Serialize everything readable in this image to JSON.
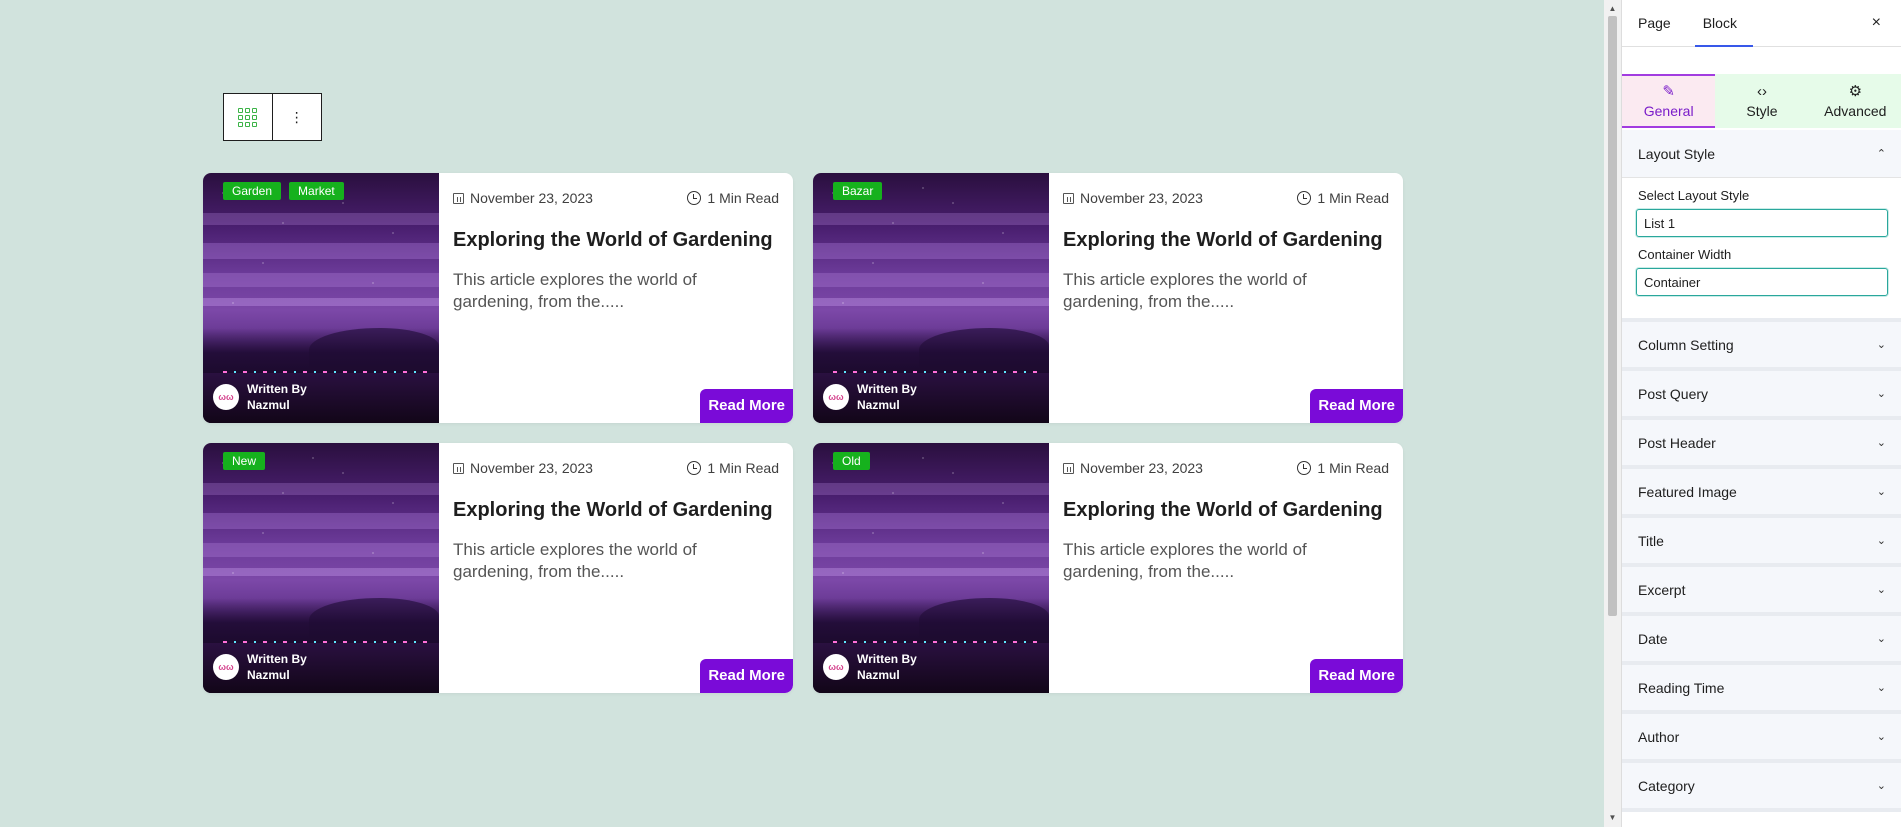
{
  "toolbar": {
    "layout_icon": "grid-layout-icon",
    "more_icon": "more-vertical-icon",
    "more_glyph": "⋮"
  },
  "posts": [
    {
      "tags": [
        "Garden",
        "Market"
      ],
      "date": "November 23, 2023",
      "read_time": "1 Min Read",
      "title": "Exploring the World of Gardening",
      "excerpt": "This article explores the world of gardening, from the.....",
      "author_prefix": "Written By",
      "author": "Nazmul",
      "cta": "Read More"
    },
    {
      "tags": [
        "Bazar"
      ],
      "date": "November 23, 2023",
      "read_time": "1 Min Read",
      "title": "Exploring the World of Gardening",
      "excerpt": "This article explores the world of gardening, from the.....",
      "author_prefix": "Written By",
      "author": "Nazmul",
      "cta": "Read More"
    },
    {
      "tags": [
        "New"
      ],
      "date": "November 23, 2023",
      "read_time": "1 Min Read",
      "title": "Exploring the World of Gardening",
      "excerpt": "This article explores the world of gardening, from the.....",
      "author_prefix": "Written By",
      "author": "Nazmul",
      "cta": "Read More"
    },
    {
      "tags": [
        "Old"
      ],
      "date": "November 23, 2023",
      "read_time": "1 Min Read",
      "title": "Exploring the World of Gardening",
      "excerpt": "This article explores the world of gardening, from the.....",
      "author_prefix": "Written By",
      "author": "Nazmul",
      "cta": "Read More"
    }
  ],
  "sidebar": {
    "tabs": [
      {
        "label": "Page"
      },
      {
        "label": "Block"
      }
    ],
    "close_glyph": "×",
    "panel_tabs": [
      {
        "label": "General",
        "glyph": "✎"
      },
      {
        "label": "Style",
        "glyph": "‹›"
      },
      {
        "label": "Advanced",
        "glyph": "⚙"
      }
    ],
    "layout_section": {
      "title": "Layout Style",
      "chevron": "⌃",
      "select_label": "Select Layout Style",
      "select_value": "List 1",
      "width_label": "Container Width",
      "width_value": "Container"
    },
    "accordions": [
      "Column Setting",
      "Post Query",
      "Post Header",
      "Featured Image",
      "Title",
      "Excerpt",
      "Date",
      "Reading Time",
      "Author",
      "Category"
    ],
    "accordion_chevron": "⌄"
  },
  "scrollbar": {
    "up": "▲",
    "down": "▼"
  },
  "colors": {
    "canvas_bg": "#d1e3dd",
    "tag_green": "#16b11d",
    "cta_purple": "#7a0bd8",
    "tab_active": "#3858e9"
  }
}
